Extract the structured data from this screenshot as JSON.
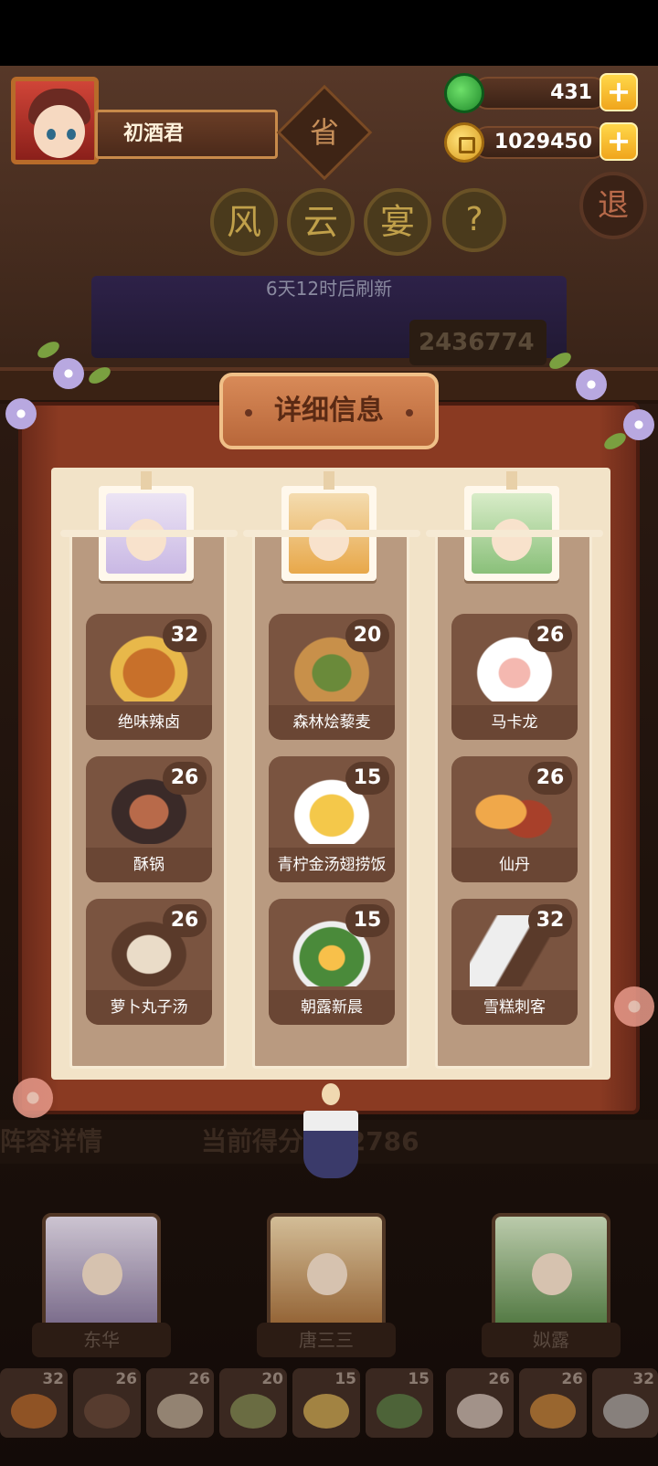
{
  "player": {
    "name": "初酒君"
  },
  "province_badge": "省",
  "resources": {
    "gems": "431",
    "coins": "1029450",
    "plus": "+"
  },
  "exit_label": "退",
  "event_title": [
    "风",
    "云",
    "宴"
  ],
  "help_label": "?",
  "refresh_text": "6天12时后刷新",
  "score_behind": "2436774",
  "panel": {
    "title": "详细信息",
    "columns": [
      {
        "character": "东华",
        "dishes": [
          {
            "name": "绝味辣卤",
            "level": "32"
          },
          {
            "name": "酥锅",
            "level": "26"
          },
          {
            "name": "萝卜丸子汤",
            "level": "26"
          }
        ]
      },
      {
        "character": "唐三三",
        "dishes": [
          {
            "name": "森林烩藜麦",
            "level": "20"
          },
          {
            "name": "青柠金汤翅捞饭",
            "level": "15"
          },
          {
            "name": "朝露新晨",
            "level": "15"
          }
        ]
      },
      {
        "character": "姒露",
        "dishes": [
          {
            "name": "马卡龙",
            "level": "26"
          },
          {
            "name": "仙丹",
            "level": "26"
          },
          {
            "name": "雪糕刺客",
            "level": "32"
          }
        ]
      }
    ]
  },
  "lower": {
    "left_label": "阵容详情",
    "score_text": "当前得分 152786"
  },
  "heroes": [
    "东华",
    "唐三三",
    "姒露"
  ],
  "mini_levels": [
    "32",
    "26",
    "26",
    "20",
    "15",
    "15",
    "26",
    "26",
    "32"
  ],
  "colors": {
    "frame": "#8a3a22",
    "panel_bg": "#f2e3c8",
    "column_bg": "#b99a80",
    "dish_bg": "#7a5440",
    "gold": "#f0a51c",
    "gem": "#1f8a2a"
  }
}
